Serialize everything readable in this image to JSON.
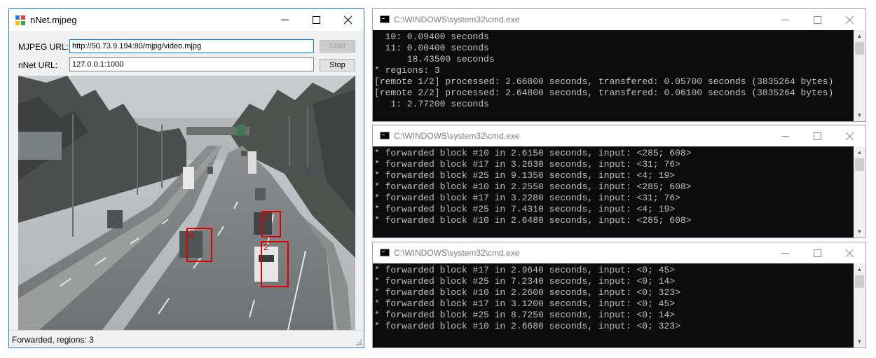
{
  "nnet_window": {
    "title": "nNet.mjpeg",
    "mjpeg_url_label": "MJPEG URL:",
    "mjpeg_url_value": "http://50.73.9.194:80/mjpg/video.mjpg",
    "nnet_url_label": "nNet URL:",
    "nnet_url_value": "127.0.0.1:1000",
    "start_button": "Start",
    "stop_button": "Stop",
    "status_text": "Forwarded, regions: 3",
    "detections": [
      {
        "label": "2"
      },
      {
        "label": "2"
      },
      {
        "label": "2"
      }
    ]
  },
  "cmd_windows": [
    {
      "title": "C:\\WINDOWS\\system32\\cmd.exe",
      "lines": [
        "  10: 0.09400 seconds",
        "  11: 0.00400 seconds",
        "      18.43500 seconds",
        "* regions: 3",
        "[remote 1/2] processed: 2.66800 seconds, transfered: 0.05700 seconds (3835264 bytes)",
        "[remote 2/2] processed: 2.64800 seconds, transfered: 0.06100 seconds (3835264 bytes)",
        "   1: 2.77200 seconds"
      ]
    },
    {
      "title": "C:\\WINDOWS\\system32\\cmd.exe",
      "lines": [
        "* forwarded block #10 in 2.6150 seconds, input: <285; 608>",
        "* forwarded block #17 in 3.2630 seconds, input: <31; 76>",
        "* forwarded block #25 in 9.1350 seconds, input: <4; 19>",
        "* forwarded block #10 in 2.2550 seconds, input: <285; 608>",
        "* forwarded block #17 in 3.2280 seconds, input: <31; 76>",
        "* forwarded block #25 in 7.4310 seconds, input: <4; 19>",
        "* forwarded block #10 in 2.6480 seconds, input: <285; 608>"
      ]
    },
    {
      "title": "C:\\WINDOWS\\system32\\cmd.exe",
      "lines": [
        "* forwarded block #17 in 2.9640 seconds, input: <0; 45>",
        "* forwarded block #25 in 7.2340 seconds, input: <0; 14>",
        "* forwarded block #10 in 2.2600 seconds, input: <0; 323>",
        "* forwarded block #17 in 3.1200 seconds, input: <0; 45>",
        "* forwarded block #25 in 8.7250 seconds, input: <0; 14>",
        "* forwarded block #10 in 2.6680 seconds, input: <0; 323>"
      ]
    }
  ],
  "colors": {
    "detection_box": "#e00000",
    "window_border": "#2b79d0",
    "console_text": "#c0c0c0",
    "console_bg": "#0c0c0c"
  }
}
